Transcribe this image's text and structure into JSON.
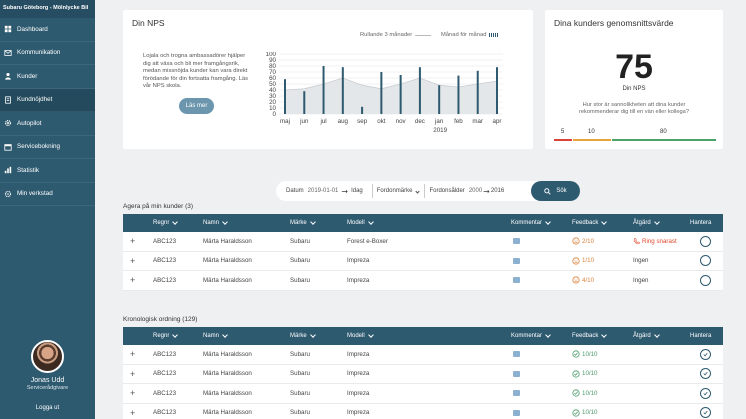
{
  "sidebar": {
    "brand": "Subaru Göteborg - Mölnlycke Bil",
    "items": [
      {
        "label": "Dashboard",
        "icon": "dashboard-icon"
      },
      {
        "label": "Kommunikation",
        "icon": "mail-icon"
      },
      {
        "label": "Kunder",
        "icon": "user-icon"
      },
      {
        "label": "Kundnöjdhet",
        "icon": "document-icon"
      },
      {
        "label": "Autopilot",
        "icon": "gear-icon"
      },
      {
        "label": "Servicebokning",
        "icon": "calendar-icon"
      },
      {
        "label": "Statistik",
        "icon": "chart-icon"
      },
      {
        "label": "Min verkstad",
        "icon": "settings-icon"
      }
    ],
    "active_index": 3,
    "user": {
      "name": "Jonas Udd",
      "role": "Servicerådgivare",
      "logout": "Logga ut"
    }
  },
  "nps_card": {
    "title": "Din NPS",
    "text": "Lojala och trogna ambassadörer hjälper dig att växa och bli mer framgångsrik, medan missnöjda kunder kan vara direkt förödande för din fortsatta framgång. Läs vår NPS skola.",
    "button": "Läs mer",
    "legend_line": "Rullande 3 månader",
    "legend_bars": "Månad för månad"
  },
  "chart_data": {
    "type": "bar",
    "categories": [
      "maj",
      "jun",
      "jul",
      "aug",
      "sep",
      "okt",
      "nov",
      "dec",
      "jan",
      "feb",
      "mar",
      "apr"
    ],
    "series": [
      {
        "name": "Månad för månad",
        "values": [
          58,
          38,
          80,
          78,
          12,
          70,
          65,
          78,
          48,
          64,
          72,
          78
        ]
      },
      {
        "name": "Rullande 3 månader",
        "values": [
          40,
          42,
          50,
          60,
          48,
          42,
          50,
          60,
          48,
          45,
          50,
          55
        ]
      }
    ],
    "year_label": "2019",
    "ylim": [
      0,
      100
    ],
    "yticks": [
      0,
      10,
      20,
      30,
      40,
      50,
      60,
      70,
      80,
      90,
      100
    ]
  },
  "avg_card": {
    "title": "Dina kunders genomsnittsvärde",
    "value": "75",
    "value_label": "Din NPS",
    "question": "Hur stor är sannolikheten att dina kunder rekommenderar dig till en vän eller kollega?",
    "scale": [
      "5",
      "10",
      "80"
    ],
    "colors": {
      "low": "#d9433a",
      "mid": "#e8a33a",
      "high": "#4aa36b"
    }
  },
  "filter": {
    "date_label": "Datum",
    "date_from": "2019-01-01",
    "date_to": "Idag",
    "brand_label": "Fordonmärke",
    "age_label": "Fordonsålder",
    "age_from": "2000",
    "age_to": "2016",
    "search": "Sök"
  },
  "columns": [
    "Regnr",
    "Namn",
    "Märke",
    "Modell",
    "Kommentar",
    "Feedback",
    "Åtgärd",
    "Hantera"
  ],
  "table1": {
    "title": "Agera på min kunder (3)",
    "rows": [
      {
        "regnr": "ABC123",
        "namn": "Märta Haraldsson",
        "marke": "Subaru",
        "modell": "Forest e-Boxer",
        "feedback": "2/10",
        "atgard": "Ring snarast"
      },
      {
        "regnr": "ABC123",
        "namn": "Märta Haraldsson",
        "marke": "Subaru",
        "modell": "Impreza",
        "feedback": "1/10",
        "atgard": "Ingen"
      },
      {
        "regnr": "ABC123",
        "namn": "Märta Haraldsson",
        "marke": "Subaru",
        "modell": "Impreza",
        "feedback": "4/10",
        "atgard": "Ingen"
      }
    ]
  },
  "table2": {
    "title": "Kronologisk ordning (129)",
    "rows": [
      {
        "regnr": "ABC123",
        "namn": "Märta Haraldsson",
        "marke": "Subaru",
        "modell": "Impreza",
        "feedback": "10/10",
        "atgard": ""
      },
      {
        "regnr": "ABC123",
        "namn": "Märta Haraldsson",
        "marke": "Subaru",
        "modell": "Impreza",
        "feedback": "10/10",
        "atgard": ""
      },
      {
        "regnr": "ABC123",
        "namn": "Märta Haraldsson",
        "marke": "Subaru",
        "modell": "Impreza",
        "feedback": "10/10",
        "atgard": ""
      },
      {
        "regnr": "ABC123",
        "namn": "Märta Haraldsson",
        "marke": "Subaru",
        "modell": "Impreza",
        "feedback": "10/10",
        "atgard": ""
      }
    ]
  }
}
